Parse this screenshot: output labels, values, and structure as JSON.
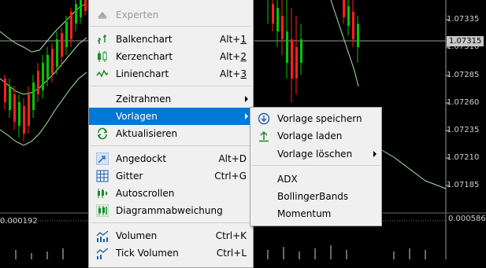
{
  "axis": {
    "prices": [
      "1.07335",
      "1.07310",
      "1.07285",
      "1.07260",
      "1.07235",
      "1.07210",
      "1.07185"
    ],
    "current_price": "1.07315",
    "indicator_right": "0.000586",
    "indicator_left": "0.000192"
  },
  "colors": {
    "bull": "#00c800",
    "bear": "#ff2020",
    "band": "#a8e8a0",
    "highlight": "#0078d7"
  },
  "context_menu": {
    "items": [
      {
        "label": "Experten",
        "icon": "expert-hat-icon",
        "disabled": true
      },
      {
        "label": "Balkenchart",
        "shortcut_prefix": "Alt+",
        "shortcut_key": "1",
        "icon": "bar-chart-icon"
      },
      {
        "label": "Kerzenchart",
        "shortcut_prefix": "Alt+",
        "shortcut_key": "2",
        "icon": "candlestick-icon"
      },
      {
        "label": "Linienchart",
        "shortcut_prefix": "Alt+",
        "shortcut_key": "3",
        "icon": "line-chart-icon"
      },
      {
        "label": "Zeitrahmen"
      },
      {
        "label": "Vorlagen"
      },
      {
        "label": "Aktualisieren",
        "icon": "refresh-icon"
      },
      {
        "label": "Angedockt",
        "shortcut": "Alt+D",
        "icon": "pin-icon"
      },
      {
        "label": "Gitter",
        "shortcut": "Ctrl+G",
        "icon": "grid-icon"
      },
      {
        "label": "Autoscrollen",
        "icon": "autoscroll-icon"
      },
      {
        "label": "Diagrammabweichung",
        "icon": "chart-shift-icon"
      },
      {
        "label": "Volumen",
        "shortcut": "Ctrl+K",
        "icon": "volume-icon"
      },
      {
        "label": "Tick Volumen",
        "shortcut": "Ctrl+L",
        "icon": "tick-volume-icon"
      }
    ]
  },
  "submenu": {
    "items": [
      {
        "label": "Vorlage speichern",
        "icon": "save-template-icon"
      },
      {
        "label": "Vorlage laden",
        "icon": "load-template-icon"
      },
      {
        "label": "Vorlage löschen"
      },
      {
        "label": "ADX"
      },
      {
        "label": "BollingerBands"
      },
      {
        "label": "Momentum"
      }
    ]
  }
}
